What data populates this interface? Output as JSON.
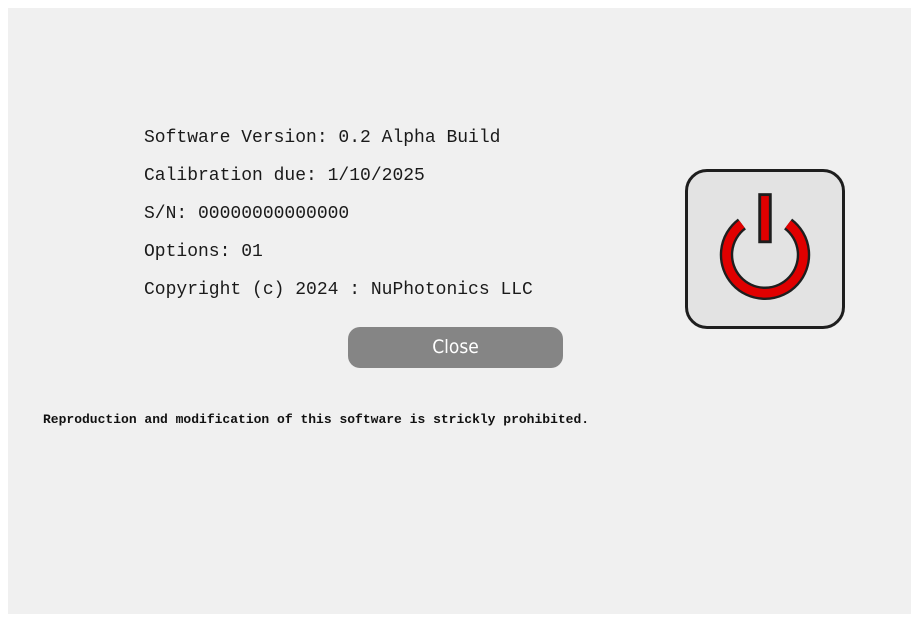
{
  "about": {
    "lines": [
      "Software Version: 0.2 Alpha Build",
      "Calibration due: 1/10/2025",
      "S/N: 00000000000000",
      "Options: 01",
      "Copyright (c) 2024 : NuPhotonics LLC"
    ],
    "close_label": "Close",
    "notice": "Reproduction and modification of this software is strickly prohibited.",
    "power_icon": "power-icon",
    "colors": {
      "background": "#f0f0f0",
      "close_button": "#858585",
      "power_symbol": "#e00000",
      "power_outline": "#1e1e1e"
    }
  }
}
